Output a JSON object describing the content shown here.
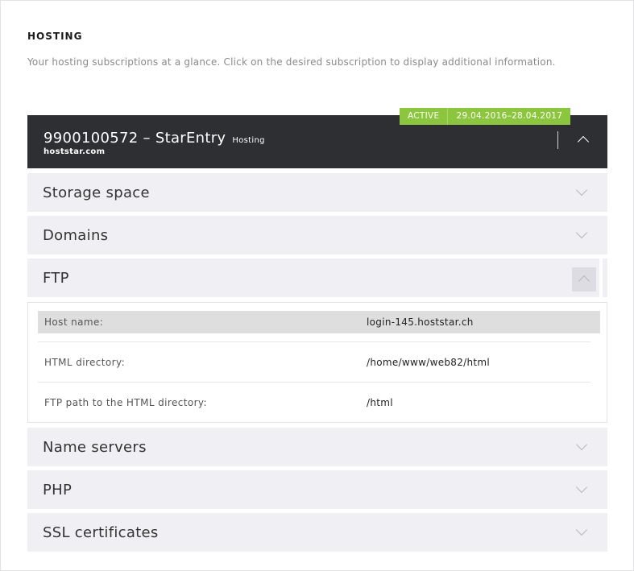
{
  "page": {
    "heading": "HOSTING",
    "intro": "Your hosting subscriptions at a glance. Click on the desired subscription to display additional information."
  },
  "subscription": {
    "status": "ACTIVE",
    "period": "29.04.2016–28.04.2017",
    "title": "9900100572 – StarEntry",
    "type": "Hosting",
    "domain": "hoststar.com",
    "status_color": "#8cc63f",
    "header_color": "#2e2f33"
  },
  "sections": {
    "storage": "Storage space",
    "domains": "Domains",
    "ftp": "FTP",
    "nameservers": "Name servers",
    "php": "PHP",
    "ssl": "SSL certificates"
  },
  "ftp": {
    "rows": [
      {
        "label": "Host name:",
        "value": "login-145.hoststar.ch"
      },
      {
        "label": "HTML directory:",
        "value": "/home/www/web82/html"
      },
      {
        "label": "FTP path to the HTML directory:",
        "value": "/html"
      }
    ]
  },
  "icons": {
    "collapse": "chevron-up-icon",
    "expand": "chevron-down-icon"
  }
}
